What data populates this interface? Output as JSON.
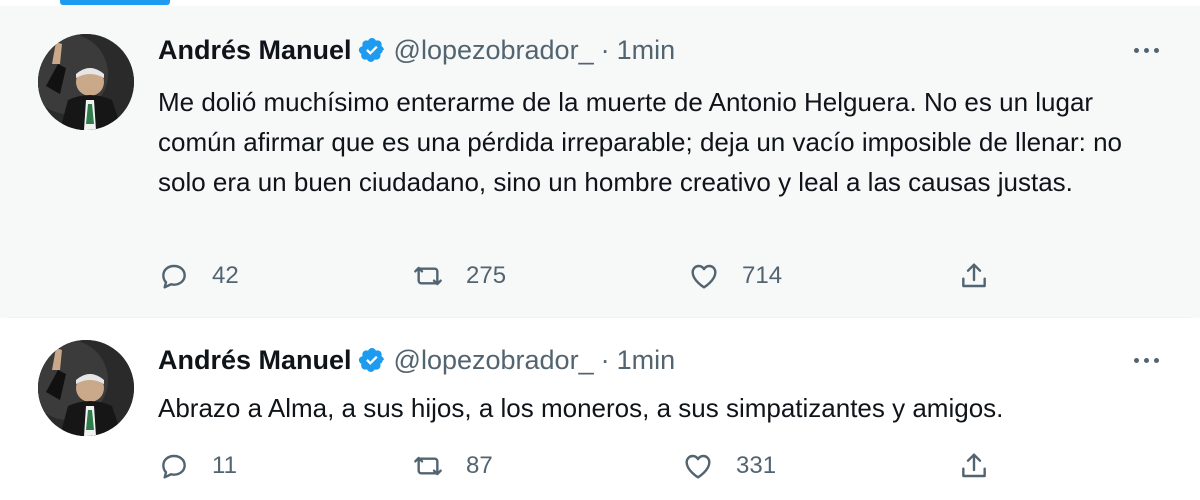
{
  "tweets": [
    {
      "author": {
        "name": "Andrés Manuel",
        "handle": "@lopezobrador_",
        "verified": true,
        "avatar": "avatar-waving-man"
      },
      "separator": "·",
      "time": "1min",
      "text": "Me dolió muchísimo enterarme de la muerte de Antonio Helguera. No es un lugar común afirmar que es una pérdida irreparable; deja un vacío imposible de llenar: no solo era un buen ciudadano, sino un hombre creativo y leal a las causas justas.",
      "metrics": {
        "replies": "42",
        "retweets": "275",
        "likes": "714"
      }
    },
    {
      "author": {
        "name": "Andrés Manuel",
        "handle": "@lopezobrador_",
        "verified": true,
        "avatar": "avatar-waving-man"
      },
      "separator": "·",
      "time": "1min",
      "text": "Abrazo a Alma, a sus hijos, a los moneros, a sus simpatizantes y amigos.",
      "metrics": {
        "replies": "11",
        "retweets": "87",
        "likes": "331"
      }
    }
  ],
  "colors": {
    "verified_badge": "#1d9bf0",
    "secondary_text": "#536471",
    "thread_line": "#cfd9de",
    "highlight_bg": "#f7f9f9"
  },
  "icons": [
    "reply-icon",
    "retweet-icon",
    "like-icon",
    "share-icon",
    "more-icon",
    "verified-icon"
  ]
}
